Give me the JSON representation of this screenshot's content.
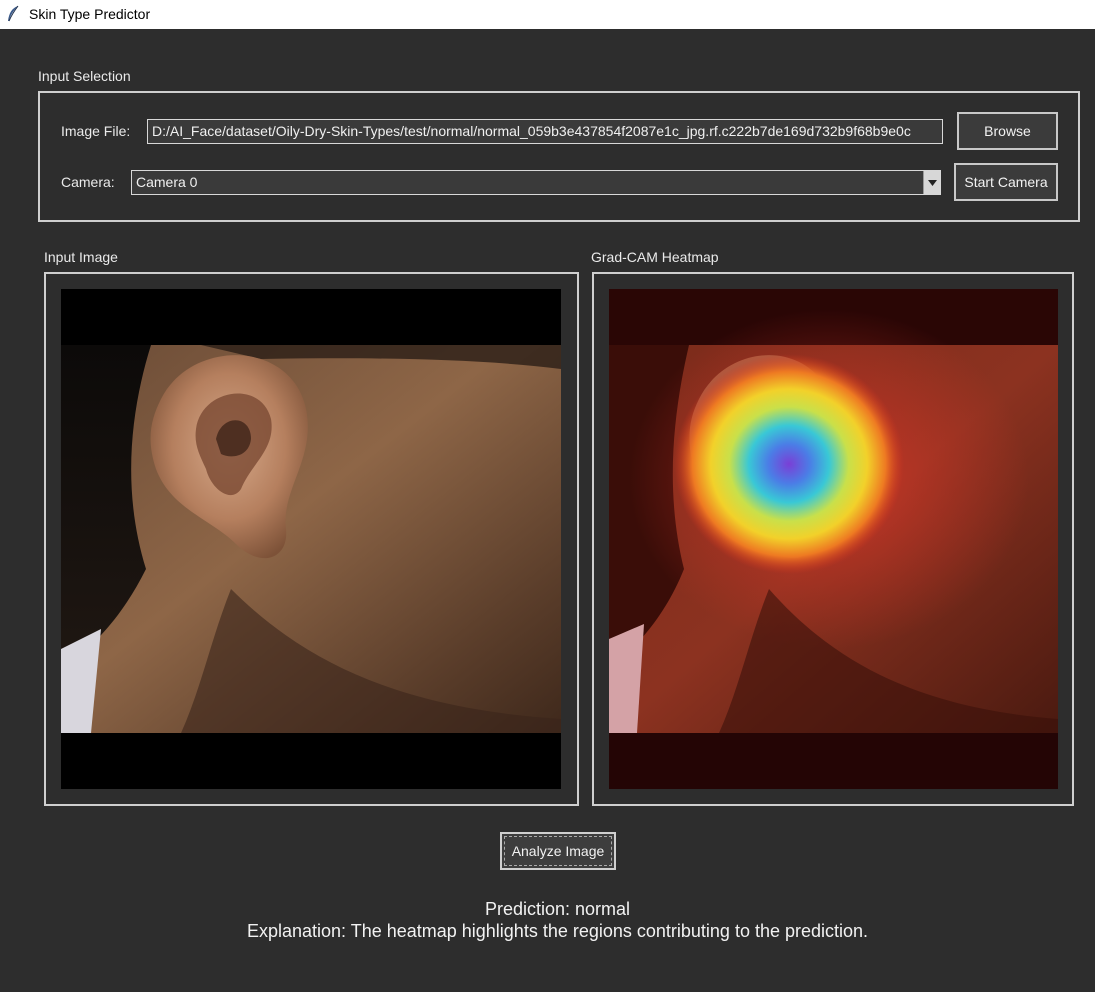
{
  "window": {
    "title": "Skin Type Predictor",
    "icon": "feather-icon"
  },
  "input_selection": {
    "group_label": "Input Selection",
    "image_file_label": "Image File:",
    "image_file_value": "D:/AI_Face/dataset/Oily-Dry-Skin-Types/test/normal/normal_059b3e437854f2087e1c_jpg.rf.c222b7de169d732b9f68b9e0c",
    "browse_label": "Browse",
    "camera_label": "Camera:",
    "camera_value": "Camera 0",
    "start_camera_label": "Start Camera"
  },
  "panels": {
    "input_image_label": "Input Image",
    "heatmap_label": "Grad-CAM Heatmap"
  },
  "analyze_label": "Analyze Image",
  "result": {
    "prediction": "Prediction: normal",
    "explanation": "Explanation: The heatmap highlights the regions contributing to the prediction."
  },
  "colors": {
    "background": "#2d2d2d",
    "border": "#cfcfcf"
  }
}
